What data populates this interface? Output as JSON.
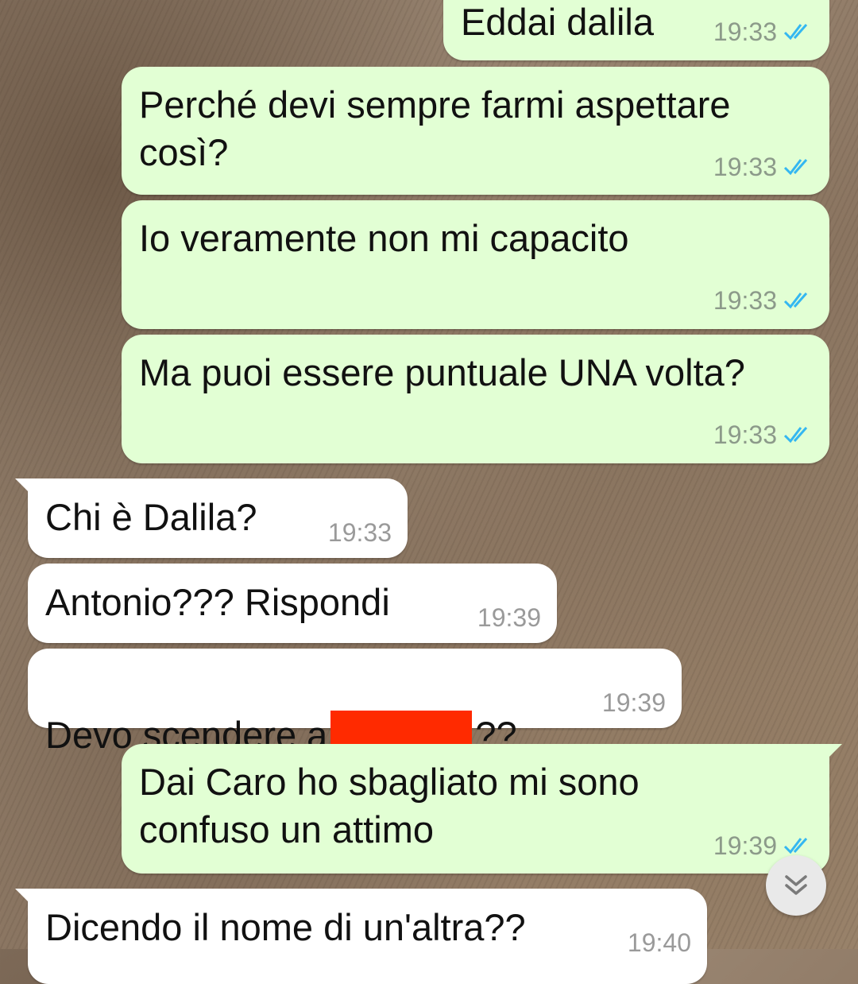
{
  "messages": [
    {
      "dir": "out",
      "text": "Eddai dalila",
      "time": "19:33"
    },
    {
      "dir": "out",
      "text": "Perché devi sempre farmi aspettare\ncosì?",
      "time": "19:33"
    },
    {
      "dir": "out",
      "text": "Io veramente non mi capacito",
      "time": "19:33"
    },
    {
      "dir": "out",
      "text": "Ma puoi essere puntuale UNA volta?",
      "time": "19:33"
    },
    {
      "dir": "in",
      "text": "Chi è Dalila?",
      "time": "19:33"
    },
    {
      "dir": "in",
      "text": "Antonio??? Rispondi",
      "time": "19:39"
    },
    {
      "dir": "in",
      "text_before": "Devo scendere a",
      "text_after": "??",
      "time": "19:39"
    },
    {
      "dir": "out",
      "text": "Dai Caro ho sbagliato mi sono\nconfuso un attimo",
      "time": "19:39"
    },
    {
      "dir": "in",
      "text": "Dicendo il nome di un'altra??",
      "time": "19:40"
    }
  ],
  "colors": {
    "outgoing": "#e2ffd4",
    "incoming": "#ffffff",
    "read_ticks": "#34b7f1",
    "redaction": "#ff2a00"
  },
  "icons": {
    "read_receipt": "double-check-icon",
    "scroll_down": "double-chevron-down-icon"
  }
}
